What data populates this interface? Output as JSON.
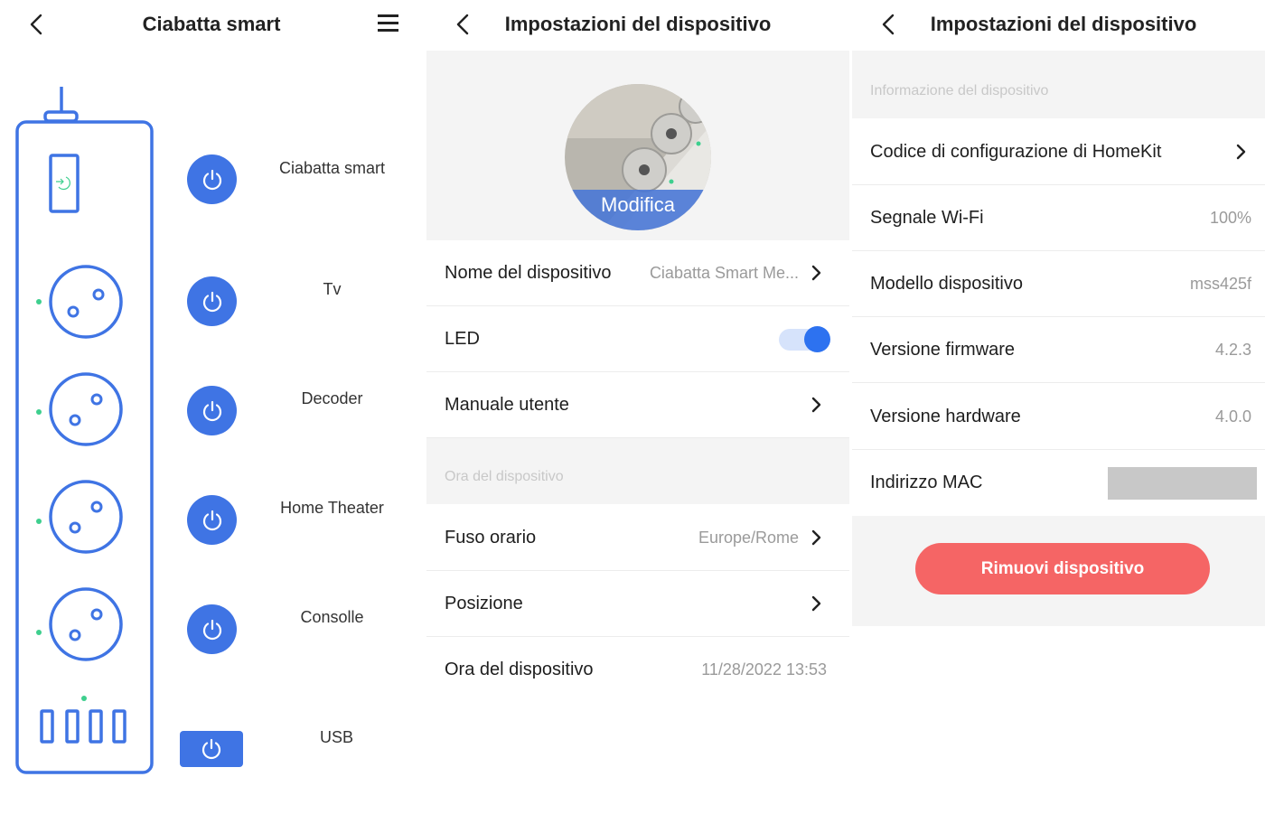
{
  "panel1": {
    "title": "Ciabatta smart",
    "outlets": [
      {
        "label": "Ciabatta smart"
      },
      {
        "label": "Tv"
      },
      {
        "label": "Decoder"
      },
      {
        "label": "Home Theater"
      },
      {
        "label": "Consolle"
      },
      {
        "label": "USB"
      }
    ]
  },
  "panel2": {
    "title": "Impostazioni del dispositivo",
    "edit_label": "Modifica",
    "rows": {
      "name": {
        "label": "Nome del dispositivo",
        "value": "Ciabatta Smart Me..."
      },
      "led": {
        "label": "LED",
        "enabled": true
      },
      "manual": {
        "label": "Manuale utente"
      },
      "section_time": "Ora del dispositivo",
      "timezone": {
        "label": "Fuso orario",
        "value": "Europe/Rome"
      },
      "position": {
        "label": "Posizione"
      },
      "device_time": {
        "label": "Ora del dispositivo",
        "value": "11/28/2022 13:53"
      }
    }
  },
  "panel3": {
    "title": "Impostazioni del dispositivo",
    "section_info": "Informazione del dispositivo",
    "rows": {
      "homekit": {
        "label": "Codice di configurazione di HomeKit"
      },
      "wifi": {
        "label": "Segnale Wi-Fi",
        "value": "100%"
      },
      "model": {
        "label": "Modello dispositivo",
        "value": "mss425f"
      },
      "firmware": {
        "label": "Versione firmware",
        "value": "4.2.3"
      },
      "hardware": {
        "label": "Versione hardware",
        "value": "4.0.0"
      },
      "mac": {
        "label": "Indirizzo MAC"
      }
    },
    "remove_label": "Rimuovi dispositivo"
  },
  "colors": {
    "accent": "#3f74e4",
    "danger": "#f56565",
    "led_green": "#3ecf8e",
    "section_bg": "#f4f4f4"
  },
  "icons": [
    "back-arrow-icon",
    "menu-icon",
    "power-icon",
    "chevron-right-icon",
    "power-strip-icon"
  ]
}
